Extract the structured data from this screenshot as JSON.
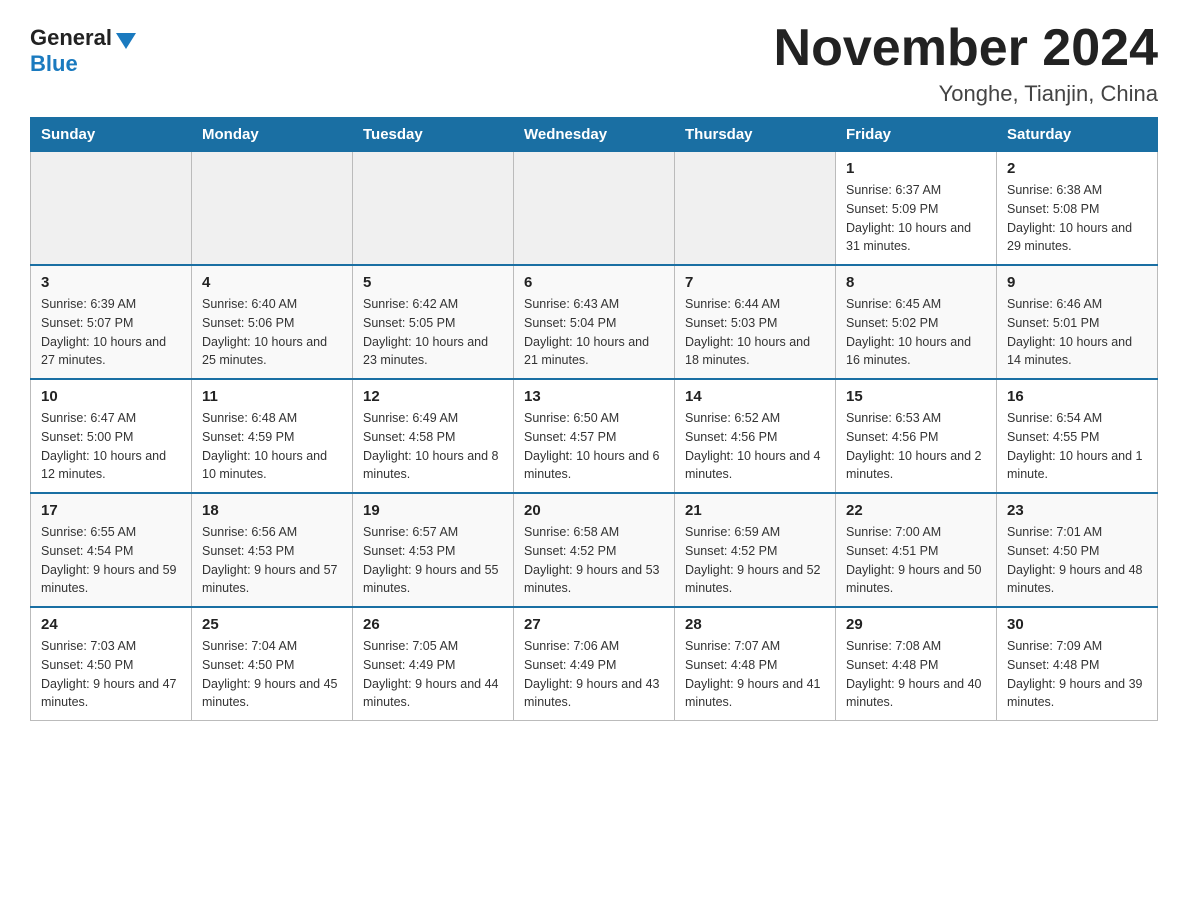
{
  "logo": {
    "general": "General",
    "blue": "Blue"
  },
  "header": {
    "month": "November 2024",
    "location": "Yonghe, Tianjin, China"
  },
  "weekdays": [
    "Sunday",
    "Monday",
    "Tuesday",
    "Wednesday",
    "Thursday",
    "Friday",
    "Saturday"
  ],
  "weeks": [
    [
      {
        "day": "",
        "info": ""
      },
      {
        "day": "",
        "info": ""
      },
      {
        "day": "",
        "info": ""
      },
      {
        "day": "",
        "info": ""
      },
      {
        "day": "",
        "info": ""
      },
      {
        "day": "1",
        "info": "Sunrise: 6:37 AM\nSunset: 5:09 PM\nDaylight: 10 hours and 31 minutes."
      },
      {
        "day": "2",
        "info": "Sunrise: 6:38 AM\nSunset: 5:08 PM\nDaylight: 10 hours and 29 minutes."
      }
    ],
    [
      {
        "day": "3",
        "info": "Sunrise: 6:39 AM\nSunset: 5:07 PM\nDaylight: 10 hours and 27 minutes."
      },
      {
        "day": "4",
        "info": "Sunrise: 6:40 AM\nSunset: 5:06 PM\nDaylight: 10 hours and 25 minutes."
      },
      {
        "day": "5",
        "info": "Sunrise: 6:42 AM\nSunset: 5:05 PM\nDaylight: 10 hours and 23 minutes."
      },
      {
        "day": "6",
        "info": "Sunrise: 6:43 AM\nSunset: 5:04 PM\nDaylight: 10 hours and 21 minutes."
      },
      {
        "day": "7",
        "info": "Sunrise: 6:44 AM\nSunset: 5:03 PM\nDaylight: 10 hours and 18 minutes."
      },
      {
        "day": "8",
        "info": "Sunrise: 6:45 AM\nSunset: 5:02 PM\nDaylight: 10 hours and 16 minutes."
      },
      {
        "day": "9",
        "info": "Sunrise: 6:46 AM\nSunset: 5:01 PM\nDaylight: 10 hours and 14 minutes."
      }
    ],
    [
      {
        "day": "10",
        "info": "Sunrise: 6:47 AM\nSunset: 5:00 PM\nDaylight: 10 hours and 12 minutes."
      },
      {
        "day": "11",
        "info": "Sunrise: 6:48 AM\nSunset: 4:59 PM\nDaylight: 10 hours and 10 minutes."
      },
      {
        "day": "12",
        "info": "Sunrise: 6:49 AM\nSunset: 4:58 PM\nDaylight: 10 hours and 8 minutes."
      },
      {
        "day": "13",
        "info": "Sunrise: 6:50 AM\nSunset: 4:57 PM\nDaylight: 10 hours and 6 minutes."
      },
      {
        "day": "14",
        "info": "Sunrise: 6:52 AM\nSunset: 4:56 PM\nDaylight: 10 hours and 4 minutes."
      },
      {
        "day": "15",
        "info": "Sunrise: 6:53 AM\nSunset: 4:56 PM\nDaylight: 10 hours and 2 minutes."
      },
      {
        "day": "16",
        "info": "Sunrise: 6:54 AM\nSunset: 4:55 PM\nDaylight: 10 hours and 1 minute."
      }
    ],
    [
      {
        "day": "17",
        "info": "Sunrise: 6:55 AM\nSunset: 4:54 PM\nDaylight: 9 hours and 59 minutes."
      },
      {
        "day": "18",
        "info": "Sunrise: 6:56 AM\nSunset: 4:53 PM\nDaylight: 9 hours and 57 minutes."
      },
      {
        "day": "19",
        "info": "Sunrise: 6:57 AM\nSunset: 4:53 PM\nDaylight: 9 hours and 55 minutes."
      },
      {
        "day": "20",
        "info": "Sunrise: 6:58 AM\nSunset: 4:52 PM\nDaylight: 9 hours and 53 minutes."
      },
      {
        "day": "21",
        "info": "Sunrise: 6:59 AM\nSunset: 4:52 PM\nDaylight: 9 hours and 52 minutes."
      },
      {
        "day": "22",
        "info": "Sunrise: 7:00 AM\nSunset: 4:51 PM\nDaylight: 9 hours and 50 minutes."
      },
      {
        "day": "23",
        "info": "Sunrise: 7:01 AM\nSunset: 4:50 PM\nDaylight: 9 hours and 48 minutes."
      }
    ],
    [
      {
        "day": "24",
        "info": "Sunrise: 7:03 AM\nSunset: 4:50 PM\nDaylight: 9 hours and 47 minutes."
      },
      {
        "day": "25",
        "info": "Sunrise: 7:04 AM\nSunset: 4:50 PM\nDaylight: 9 hours and 45 minutes."
      },
      {
        "day": "26",
        "info": "Sunrise: 7:05 AM\nSunset: 4:49 PM\nDaylight: 9 hours and 44 minutes."
      },
      {
        "day": "27",
        "info": "Sunrise: 7:06 AM\nSunset: 4:49 PM\nDaylight: 9 hours and 43 minutes."
      },
      {
        "day": "28",
        "info": "Sunrise: 7:07 AM\nSunset: 4:48 PM\nDaylight: 9 hours and 41 minutes."
      },
      {
        "day": "29",
        "info": "Sunrise: 7:08 AM\nSunset: 4:48 PM\nDaylight: 9 hours and 40 minutes."
      },
      {
        "day": "30",
        "info": "Sunrise: 7:09 AM\nSunset: 4:48 PM\nDaylight: 9 hours and 39 minutes."
      }
    ]
  ]
}
